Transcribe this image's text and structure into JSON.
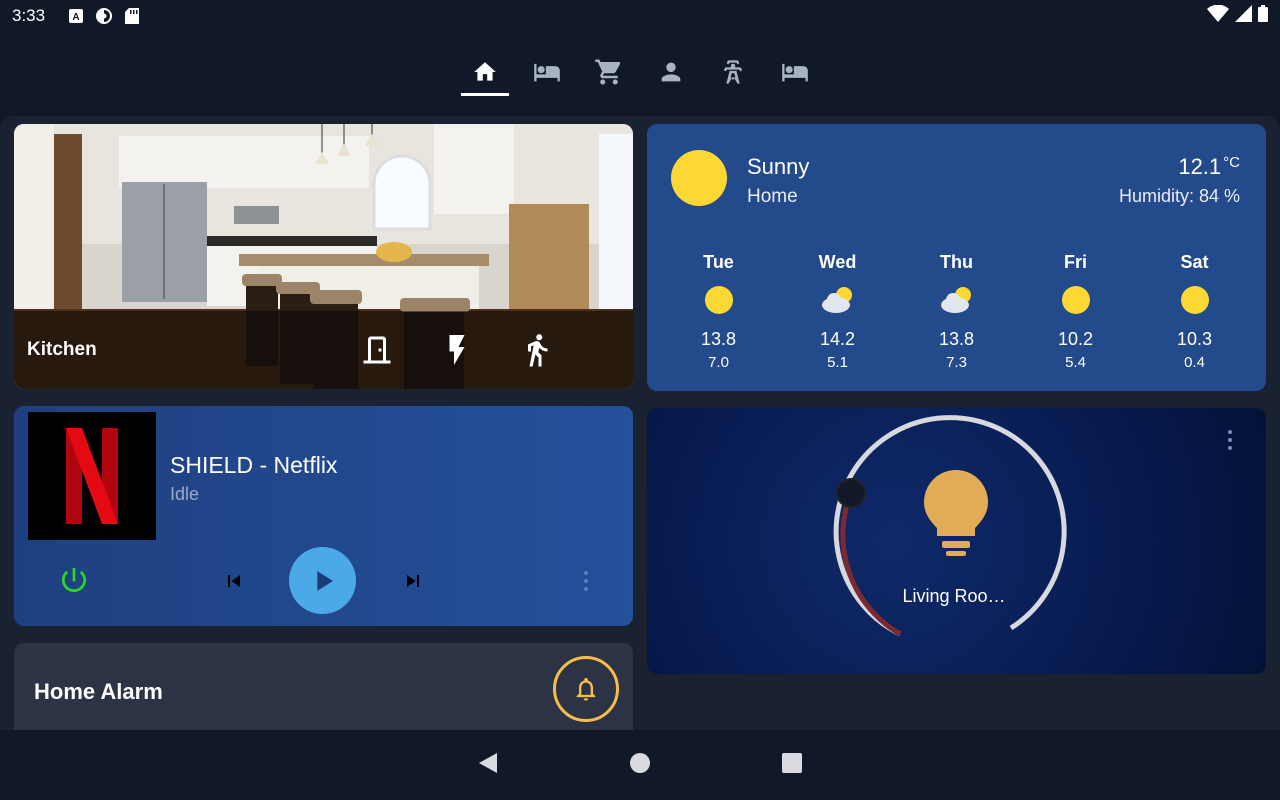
{
  "status_bar": {
    "time": "3:33",
    "icons": [
      "a-notification-icon",
      "sync-icon",
      "sd-card-icon",
      "wifi-icon",
      "signal-icon",
      "battery-icon"
    ]
  },
  "tabs": [
    {
      "name": "home-icon",
      "active": true
    },
    {
      "name": "bed-icon",
      "active": false
    },
    {
      "name": "cart-icon",
      "active": false
    },
    {
      "name": "person-icon",
      "active": false
    },
    {
      "name": "transmission-tower-icon",
      "active": false
    },
    {
      "name": "bed-icon",
      "active": false
    }
  ],
  "kitchen": {
    "title": "Kitchen",
    "entities": [
      "door-icon",
      "flash-icon",
      "walk-icon"
    ]
  },
  "weather": {
    "state": "Sunny",
    "name": "Home",
    "temperature": "12.1",
    "unit": "°C",
    "humidity": "Humidity: 84 %",
    "forecast": [
      {
        "day": "Tue",
        "condition": "sunny",
        "high": "13.8",
        "low": "7.0"
      },
      {
        "day": "Wed",
        "condition": "partlycloudy",
        "high": "14.2",
        "low": "5.1"
      },
      {
        "day": "Thu",
        "condition": "partlycloudy",
        "high": "13.8",
        "low": "7.3"
      },
      {
        "day": "Fri",
        "condition": "sunny",
        "high": "10.2",
        "low": "5.4"
      },
      {
        "day": "Sat",
        "condition": "sunny",
        "high": "10.3",
        "low": "0.4"
      }
    ]
  },
  "media": {
    "title": "SHIELD - Netflix",
    "state": "Idle",
    "power_color": "#22dd22"
  },
  "light": {
    "name": "Living Roo…",
    "bulb_color": "#e0ad56",
    "brightness_fraction": 0.22
  },
  "alarm": {
    "title": "Home Alarm",
    "accent": "#f6bd4a"
  },
  "colors": {
    "background": "#111827",
    "card_blue": "#234a8a",
    "sun": "#fdd835"
  }
}
